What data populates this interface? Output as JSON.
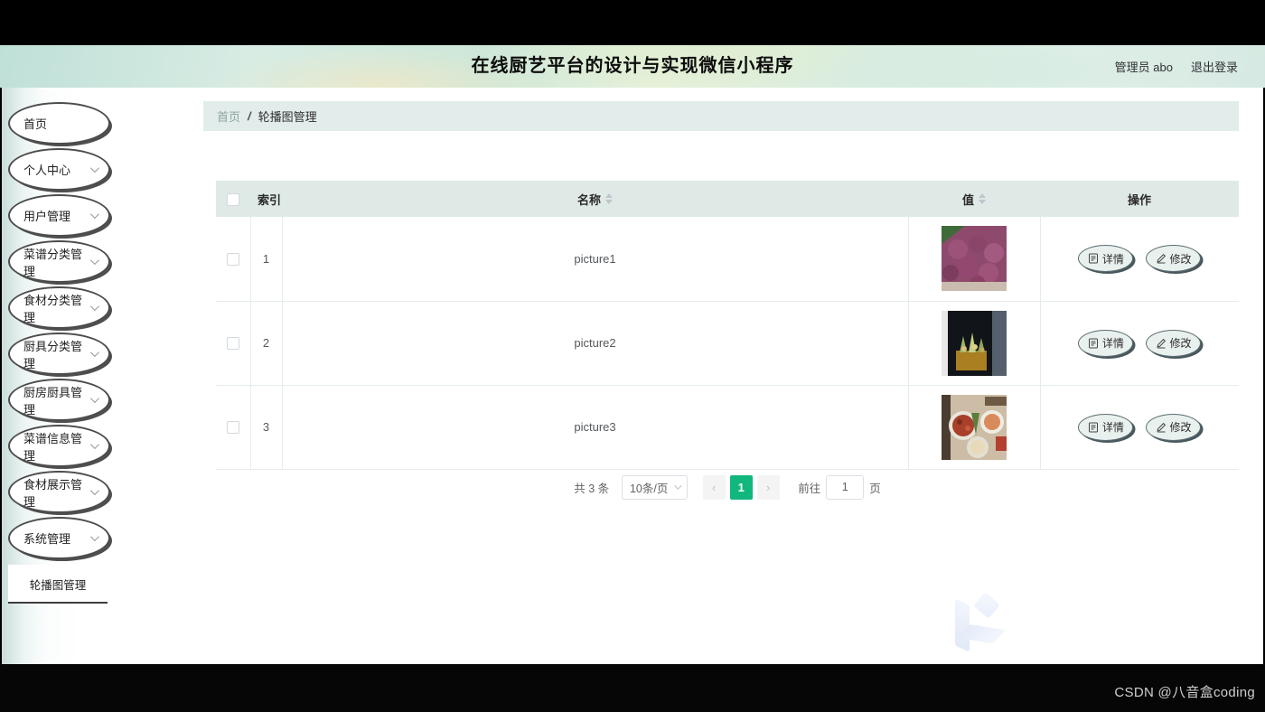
{
  "header": {
    "title": "在线厨艺平台的设计与实现微信小程序",
    "user_label": "管理员 abo",
    "logout_label": "退出登录"
  },
  "sidebar": {
    "items": [
      {
        "label": "首页",
        "expandable": false
      },
      {
        "label": "个人中心",
        "expandable": true
      },
      {
        "label": "用户管理",
        "expandable": true
      },
      {
        "label": "菜谱分类管理",
        "expandable": true
      },
      {
        "label": "食材分类管理",
        "expandable": true
      },
      {
        "label": "厨具分类管理",
        "expandable": true
      },
      {
        "label": "厨房厨具管理",
        "expandable": true
      },
      {
        "label": "菜谱信息管理",
        "expandable": true
      },
      {
        "label": "食材展示管理",
        "expandable": true
      },
      {
        "label": "系统管理",
        "expandable": true
      }
    ],
    "active_submenu": "轮播图管理"
  },
  "breadcrumb": {
    "home": "首页",
    "separator": "/",
    "current": "轮播图管理"
  },
  "table": {
    "columns": {
      "index": "索引",
      "name": "名称",
      "value": "值",
      "actions": "操作"
    },
    "rows": [
      {
        "index": "1",
        "name": "picture1",
        "image_desc": "red-onions-photo"
      },
      {
        "index": "2",
        "name": "picture2",
        "image_desc": "appetizers-on-dark-background-photo"
      },
      {
        "index": "3",
        "name": "picture3",
        "image_desc": "plated-asian-dishes-photo"
      }
    ],
    "actions": {
      "detail": "详情",
      "edit": "修改"
    }
  },
  "pagination": {
    "total": "共 3 条",
    "page_size": "10条/页",
    "current_page": "1",
    "goto_prefix": "前往",
    "goto_value": "1",
    "goto_suffix": "页"
  },
  "watermark": {
    "text": "CSDN @八音盒coding"
  },
  "colors": {
    "active_page_green": "#12b77d",
    "table_header_bg": "#dfeae7",
    "breadcrumb_bg": "#e2edeb",
    "header_tint": "#d5e9e0"
  }
}
